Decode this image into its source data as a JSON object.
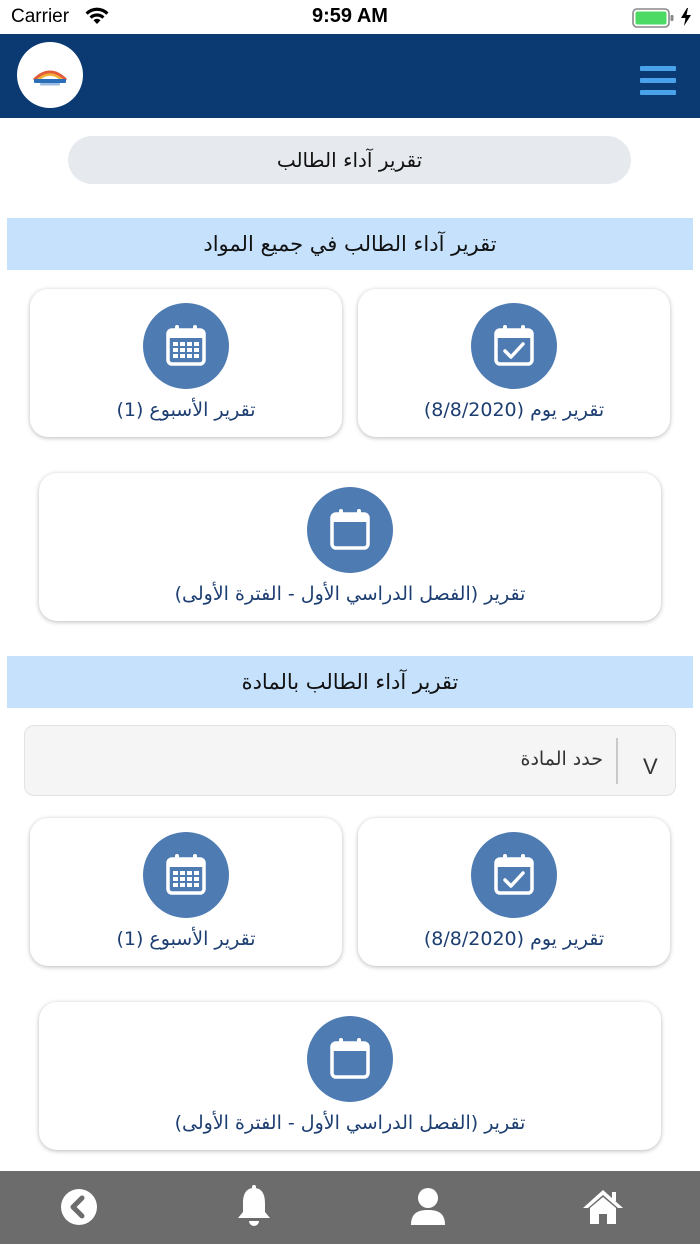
{
  "status_bar": {
    "carrier": "Carrier",
    "time": "9:59 AM"
  },
  "header": {
    "logo_icon": "school-logo",
    "menu_icon": "hamburger-menu-icon"
  },
  "page_title": "تقرير آداء الطالب",
  "all_subjects_section": {
    "title": "تقرير آداء الطالب في جميع المواد",
    "cards": {
      "day": {
        "label": "تقرير يوم (8/8/2020)",
        "icon": "calendar-check-icon"
      },
      "week": {
        "label": "تقرير الأسبوع (1)",
        "icon": "calendar-grid-icon"
      },
      "term": {
        "label": "تقرير (الفصل الدراسي الأول - الفترة الأولى)",
        "icon": "calendar-icon"
      }
    }
  },
  "by_subject_section": {
    "title": "تقرير آداء الطالب بالمادة",
    "select": {
      "placeholder": "حدد المادة",
      "chevron": "V"
    },
    "cards": {
      "day": {
        "label": "تقرير يوم (8/8/2020)",
        "icon": "calendar-check-icon"
      },
      "week": {
        "label": "تقرير الأسبوع (1)",
        "icon": "calendar-grid-icon"
      },
      "term": {
        "label": "تقرير (الفصل الدراسي الأول - الفترة الأولى)",
        "icon": "calendar-icon"
      }
    }
  },
  "bottom_nav": {
    "items": [
      "back-icon",
      "bell-icon",
      "user-icon",
      "home-icon"
    ]
  },
  "colors": {
    "header_bg": "#0b3a72",
    "menu_icon": "#4aa3ea",
    "section_bg": "#c5e1fb",
    "icon_circle": "#4e7bb2",
    "card_text": "#1d3e71",
    "bottom_bar": "#6c6c6c",
    "battery": "#4cd964"
  }
}
